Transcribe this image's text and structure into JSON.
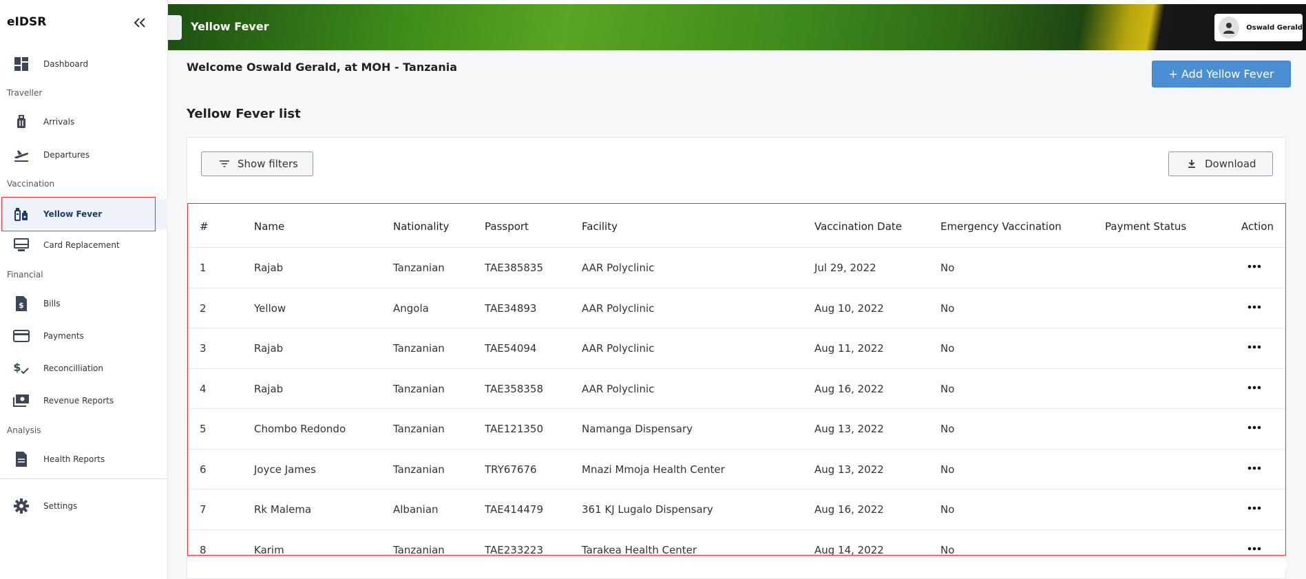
{
  "app": {
    "brand": "eIDSR"
  },
  "sidebar": {
    "dashboard": "Dashboard",
    "section_traveller": "Traveller",
    "arrivals": "Arrivals",
    "departures": "Departures",
    "section_vaccination": "Vaccination",
    "yellow_fever": "Yellow Fever",
    "card_replacement": "Card Replacement",
    "section_financial": "Financial",
    "bills": "Bills",
    "payments": "Payments",
    "reconciliation": "Reconcilliation",
    "revenue_reports": "Revenue Reports",
    "section_analysis": "Analysis",
    "health_reports": "Health Reports",
    "settings": "Settings"
  },
  "header": {
    "title": "Yellow Fever",
    "user_name": "Oswald Gerald"
  },
  "main": {
    "welcome": "Welcome Oswald Gerald, at MOH - Tanzania",
    "add_button": "+  Add Yellow Fever",
    "list_title": "Yellow Fever list",
    "show_filters": "Show filters",
    "download": "Download"
  },
  "table": {
    "columns": [
      "#",
      "Name",
      "Nationality",
      "Passport",
      "Facility",
      "Vaccination Date",
      "Emergency Vaccination",
      "Payment Status",
      "Action"
    ],
    "rows": [
      [
        "1",
        "Rajab",
        "Tanzanian",
        "TAE385835",
        "AAR Polyclinic",
        "Jul 29, 2022",
        "No",
        ""
      ],
      [
        "2",
        "Yellow",
        "Angola",
        "TAE34893",
        "AAR Polyclinic",
        "Aug 10, 2022",
        "No",
        ""
      ],
      [
        "3",
        "Rajab",
        "Tanzanian",
        "TAE54094",
        "AAR Polyclinic",
        "Aug 11, 2022",
        "No",
        ""
      ],
      [
        "4",
        "Rajab",
        "Tanzanian",
        "TAE358358",
        "AAR Polyclinic",
        "Aug 16, 2022",
        "No",
        ""
      ],
      [
        "5",
        "Chombo Redondo",
        "Tanzanian",
        "TAE121350",
        "Namanga Dispensary",
        "Aug 13, 2022",
        "No",
        ""
      ],
      [
        "6",
        "Joyce James",
        "Tanzanian",
        "TRY67676",
        "Mnazi Mmoja Health Center",
        "Aug 13, 2022",
        "No",
        ""
      ],
      [
        "7",
        "Rk Malema",
        "Albanian",
        "TAE414479",
        "361 KJ Lugalo Dispensary",
        "Aug 16, 2022",
        "No",
        ""
      ],
      [
        "8",
        "Karim",
        "Tanzanian",
        "TAE233223",
        "Tarakea Health Center",
        "Aug 14, 2022",
        "No",
        ""
      ]
    ]
  },
  "colors": {
    "accent": "#4a8fd3",
    "highlight": "#e5333b",
    "active_text": "#1d3a6e"
  }
}
